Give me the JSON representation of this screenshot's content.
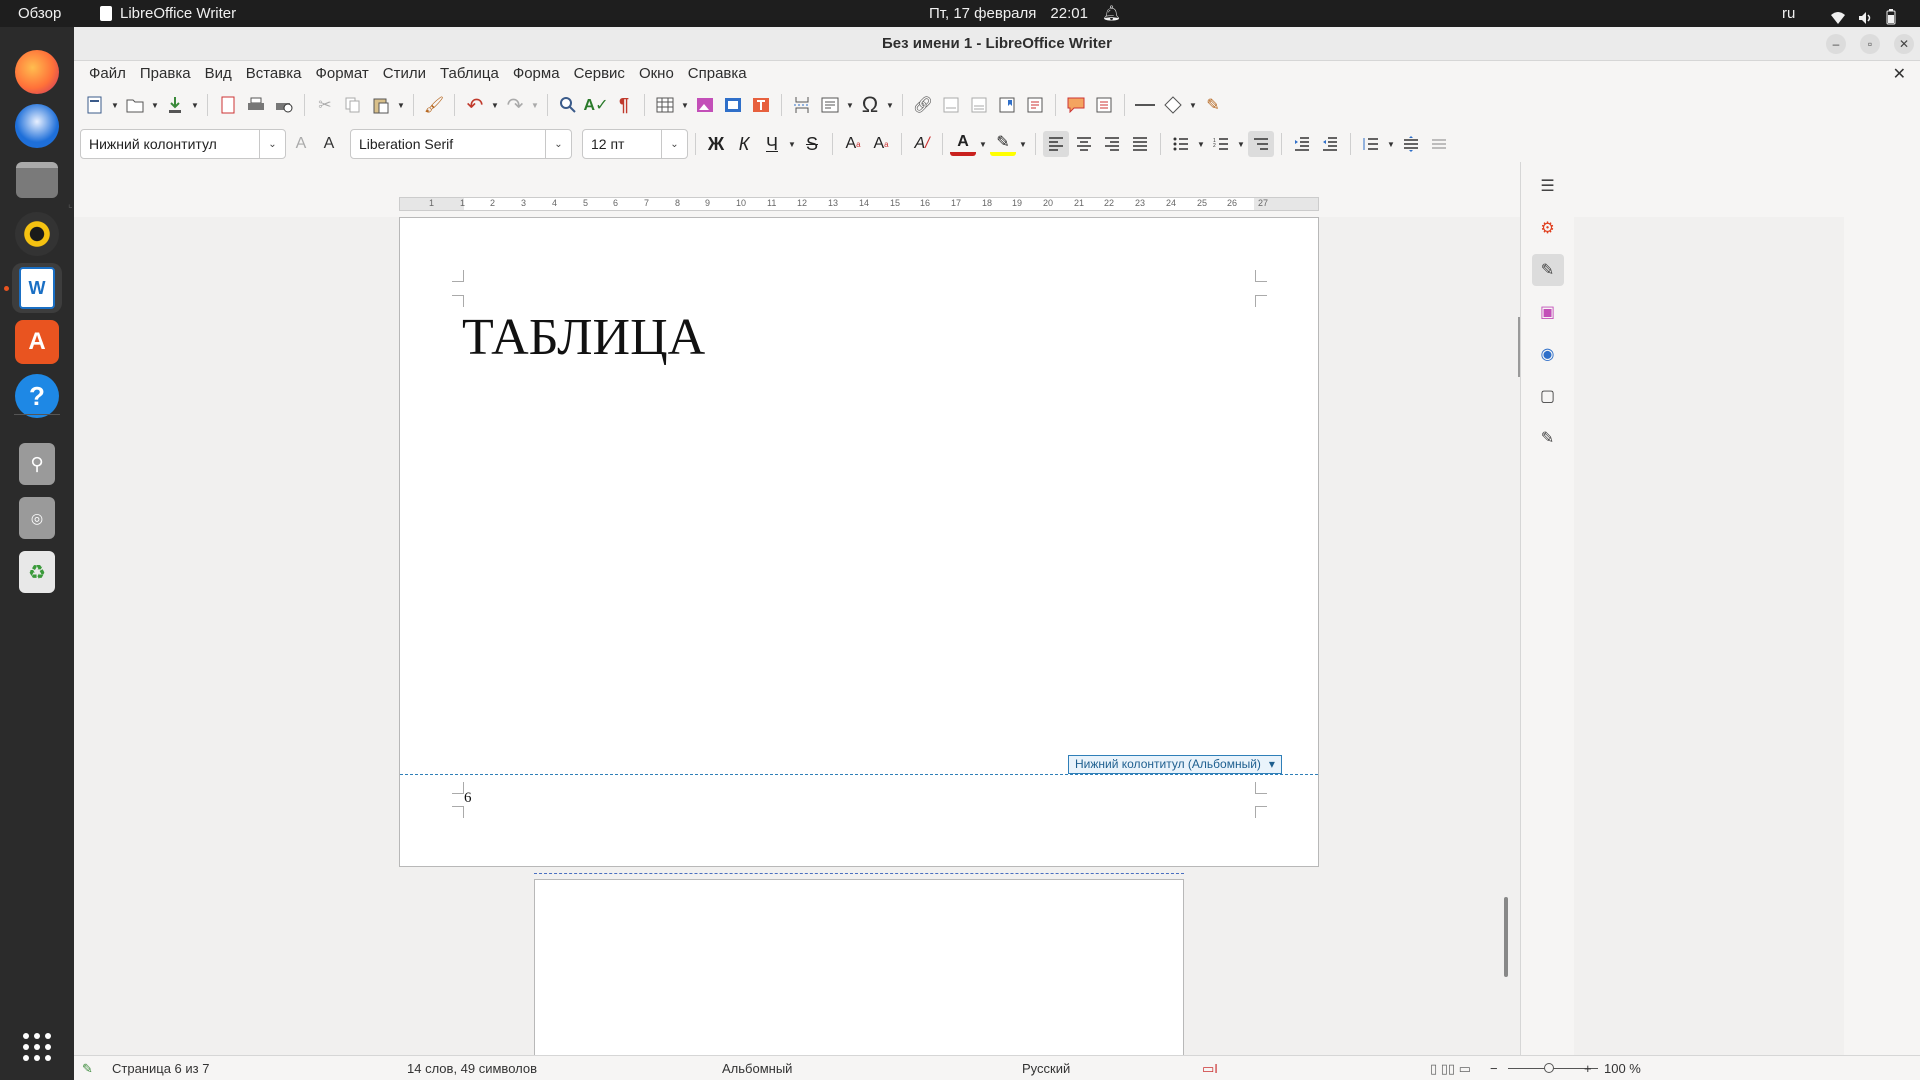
{
  "topbar": {
    "activities": "Обзор",
    "app_name": "LibreOffice Writer",
    "date": "Пт, 17 февраля",
    "time": "22:01",
    "lang": "ru"
  },
  "dock": {
    "items": [
      "firefox-icon",
      "thunderbird-icon",
      "files-icon",
      "rhythmbox-icon",
      "writer-icon",
      "app-center-icon",
      "help-icon",
      "usb-drive-icon",
      "optical-drive-icon",
      "trash-icon",
      "show-apps-icon"
    ]
  },
  "window": {
    "title": "Без имени 1 - LibreOffice Writer"
  },
  "menu": {
    "items": [
      "Файл",
      "Правка",
      "Вид",
      "Вставка",
      "Формат",
      "Стили",
      "Таблица",
      "Форма",
      "Сервис",
      "Окно",
      "Справка"
    ]
  },
  "format": {
    "paragraph_style": "Нижний колонтитул",
    "font_name": "Liberation Serif",
    "font_size": "12 пт",
    "bold": "Ж",
    "italic": "К",
    "underline": "Ч"
  },
  "document": {
    "heading": "ТАБЛИЦА",
    "footer_tag": "Нижний колонтитул (Альбомный)",
    "page_number": "6"
  },
  "ruler": {
    "ticks": [
      "1",
      "1",
      "2",
      "3",
      "4",
      "5",
      "6",
      "7",
      "8",
      "9",
      "10",
      "11",
      "12",
      "13",
      "14",
      "15",
      "16",
      "17",
      "18",
      "19",
      "20",
      "21",
      "22",
      "23",
      "24",
      "25",
      "26",
      "27"
    ]
  },
  "statusbar": {
    "page": "Страница 6 из 7",
    "words": "14 слов, 49 символов",
    "page_style": "Альбомный",
    "language": "Русский",
    "zoom": "100 %"
  },
  "colors": {
    "ubuntu_orange": "#e95420",
    "footer_blue": "#2f7fb8",
    "font_color_red": "#c9211e",
    "highlight_yellow": "#ffff00"
  }
}
